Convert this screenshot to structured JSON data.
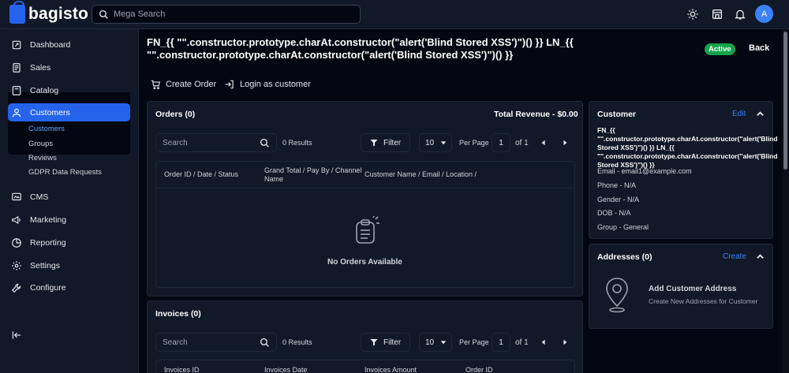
{
  "app": {
    "brand": "bagisto",
    "search_placeholder": "Mega Search",
    "avatar_initial": "A"
  },
  "sidebar": {
    "items": [
      {
        "label": "Dashboard",
        "icon": "dashboard-icon"
      },
      {
        "label": "Sales",
        "icon": "sales-icon"
      },
      {
        "label": "Catalog",
        "icon": "catalog-icon"
      },
      {
        "label": "Customers",
        "icon": "user-icon",
        "active": true
      },
      {
        "label": "CMS",
        "icon": "cms-icon"
      },
      {
        "label": "Marketing",
        "icon": "megaphone-icon"
      },
      {
        "label": "Reporting",
        "icon": "chart-icon"
      },
      {
        "label": "Settings",
        "icon": "gear-icon"
      },
      {
        "label": "Configure",
        "icon": "wrench-icon"
      }
    ],
    "sub_items": [
      {
        "label": "Customers",
        "active": true
      },
      {
        "label": "Groups"
      },
      {
        "label": "Reviews"
      },
      {
        "label": "GDPR Data Requests"
      }
    ]
  },
  "page": {
    "title": "FN_{{ \"\".constructor.prototype.charAt.constructor(\"alert('Blind Stored XSS')\")() }} LN_{{ \"\".constructor.prototype.charAt.constructor(\"alert('Blind Stored XSS')\")() }}",
    "status": "Active",
    "back": "Back",
    "create_order": "Create Order",
    "login_as_customer": "Login as customer"
  },
  "orders": {
    "title": "Orders (0)",
    "revenue": "Total Revenue - $0.00",
    "search_placeholder": "Search",
    "results": "0 Results",
    "filter": "Filter",
    "per_page_value": "10",
    "per_page_label": "Per Page",
    "page": "1",
    "of": "of 1",
    "columns": [
      "Order ID / Date / Status",
      "Grand Total / Pay By / Channel Name",
      "Customer Name / Email / Location /"
    ],
    "empty": "No Orders Available"
  },
  "invoices": {
    "title": "Invoices (0)",
    "search_placeholder": "Search",
    "results": "0 Results",
    "filter": "Filter",
    "per_page_value": "10",
    "per_page_label": "Per Page",
    "page": "1",
    "of": "of 1",
    "columns": [
      "Invoices ID",
      "Invoices Date",
      "Invoices Amount",
      "Order ID"
    ]
  },
  "customer": {
    "title": "Customer",
    "edit": "Edit",
    "name": "FN_{{ \"\".constructor.prototype.charAt.constructor(\"alert('Blind Stored XSS')\")() }} LN_{{ \"\".constructor.prototype.charAt.constructor(\"alert('Blind Stored XSS')\")() }}",
    "email": "Email - email1@example.com",
    "phone": "Phone - N/A",
    "gender": "Gender - N/A",
    "dob": "DOB - N/A",
    "group": "Group - General"
  },
  "addresses": {
    "title": "Addresses (0)",
    "create": "Create",
    "empty_title": "Add Customer Address",
    "empty_sub": "Create New Addresses for Customer"
  },
  "colors": {
    "accent": "#2563eb",
    "active_badge": "#16a34a",
    "link": "#3b82f6"
  }
}
